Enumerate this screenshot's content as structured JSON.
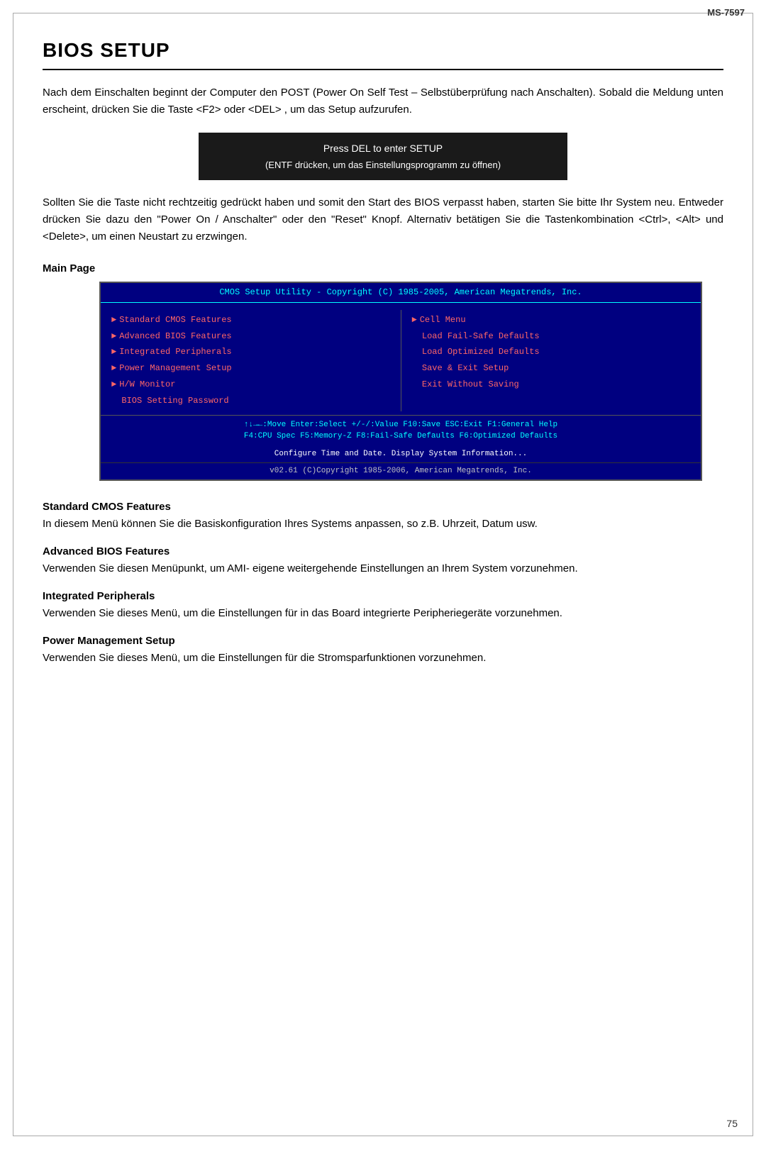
{
  "model": "MS-7597",
  "page_number": "75",
  "title": "BIOS SETUP",
  "intro_paragraph": "Nach dem Einschalten beginnt der Computer den POST (Power On Self Test – Selbstüberprüfung nach Anschalten). Sobald die Meldung unten erscheint, drücken Sie die Taste <F2> oder <DEL> , um das Setup aufzurufen.",
  "bios_prompt": {
    "line1": "Press DEL to enter SETUP",
    "line2": "(ENTF drücken, um das Einstellungsprogramm zu öffnen)"
  },
  "continuation_paragraph": "Sollten Sie die Taste nicht rechtzeitig gedrückt haben und somit den Start des BIOS verpasst haben, starten Sie bitte Ihr System neu. Entweder drücken Sie dazu den \"Power On / Anschalter\" oder den \"Reset\" Knopf. Alternativ betätigen Sie die Tastenkombination <Ctrl>, <Alt> und <Delete>, um einen Neustart zu erzwingen.",
  "main_page_heading": "Main Page",
  "bios_screen": {
    "title_bar": "CMOS Setup Utility - Copyright (C) 1985-2005, American Megatrends, Inc.",
    "left_items": [
      {
        "arrow": true,
        "label": "Standard CMOS Features"
      },
      {
        "arrow": true,
        "label": "Advanced BIOS Features"
      },
      {
        "arrow": true,
        "label": "Integrated Peripherals"
      },
      {
        "arrow": true,
        "label": "Power Management Setup"
      },
      {
        "arrow": true,
        "label": "H/W Monitor"
      },
      {
        "arrow": false,
        "label": "BIOS Setting Password"
      }
    ],
    "right_items": [
      {
        "arrow": true,
        "label": "Cell Menu"
      },
      {
        "arrow": false,
        "label": "Load Fail-Safe Defaults"
      },
      {
        "arrow": false,
        "label": "Load Optimized Defaults"
      },
      {
        "arrow": false,
        "label": "Save & Exit Setup"
      },
      {
        "arrow": false,
        "label": "Exit Without Saving"
      }
    ],
    "footer_line1": "↑↓→←:Move  Enter:Select  +/-/:Value  F10:Save  ESC:Exit  F1:General Help",
    "footer_line2": "F4:CPU Spec  F5:Memory-Z  F8:Fail-Safe Defaults  F6:Optimized Defaults",
    "info_bar": "Configure Time and Date.  Display System Information...",
    "copyright_bar": "v02.61 (C)Copyright 1985-2006, American Megatrends, Inc."
  },
  "features": [
    {
      "id": "standard-cmos",
      "title": "Standard CMOS Features",
      "text": "In diesem Menü können Sie die Basiskonfiguration Ihres Systems anpassen, so z.B. Uhrzeit, Datum usw."
    },
    {
      "id": "advanced-bios",
      "title": "Advanced BIOS Features",
      "text": "Verwenden Sie diesen Menüpunkt, um AMI- eigene weitergehende Einstellungen an Ihrem System vorzunehmen."
    },
    {
      "id": "integrated-peripherals",
      "title": "Integrated Peripherals",
      "text": "Verwenden Sie dieses Menü, um die Einstellungen für in das Board integrierte Peripheriegeräte vorzunehmen."
    },
    {
      "id": "power-management",
      "title": "Power Management Setup",
      "text": "Verwenden Sie dieses Menü, um die Einstellungen für die Stromsparfunktionen vorzunehmen."
    }
  ]
}
